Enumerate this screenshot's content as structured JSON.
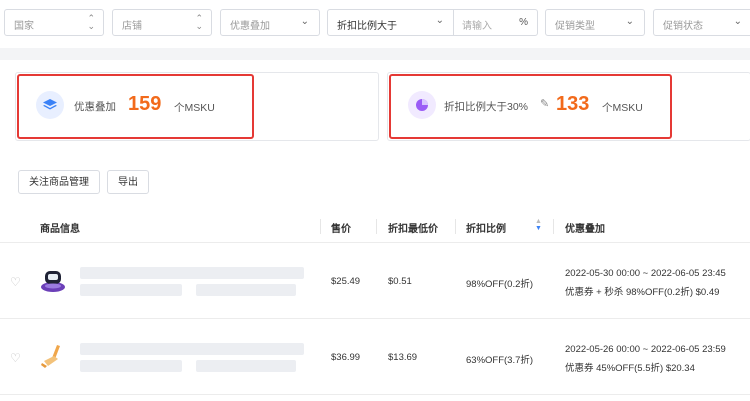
{
  "filters": {
    "country": "国家",
    "store": "店铺",
    "promo_stack": "优惠叠加",
    "discount_op": "折扣比例大于",
    "discount_input_placeholder": "请输入",
    "percent_unit": "%",
    "promo_type": "促销类型",
    "promo_status": "促销状态"
  },
  "cards": [
    {
      "label": "优惠叠加",
      "count": "159",
      "unit": "个MSKU",
      "icon": "layers-icon",
      "color": "#3b82f6"
    },
    {
      "label": "折扣比例大于30%",
      "count": "133",
      "unit": "个MSKU",
      "icon": "pie-chart-icon",
      "color": "#9b5cf6"
    }
  ],
  "actions": {
    "follow_manage": "关注商品管理",
    "export": "导出"
  },
  "table": {
    "headers": {
      "product_info": "商品信息",
      "price": "售价",
      "min_discount_price": "折扣最低价",
      "discount_ratio": "折扣比例",
      "promo_stack": "优惠叠加"
    },
    "rows": [
      {
        "price": "$25.49",
        "min_price": "$0.51",
        "discount": "98%OFF(0.2折)",
        "period": "2022-05-30 00:00 ~ 2022-06-05 23:45",
        "promo": "优惠券 + 秒杀 98%OFF(0.2折) $0.49"
      },
      {
        "price": "$36.99",
        "min_price": "$13.69",
        "discount": "63%OFF(3.7折)",
        "period": "2022-05-26 00:00 ~ 2022-06-05 23:59",
        "promo": "优惠券 45%OFF(5.5折) $20.34"
      }
    ]
  }
}
